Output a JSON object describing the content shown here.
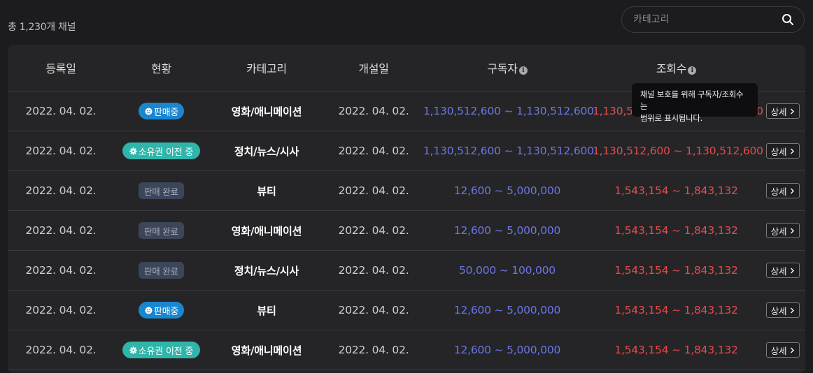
{
  "summary": "총 1,230개 채널",
  "search": {
    "placeholder": "카테고리"
  },
  "colors": {
    "subscribers": "#6b77e6",
    "views": "#e84a4a",
    "badge_sale": "#1a86d0",
    "badge_transfer": "#2fb5a9",
    "badge_done": "#3c4559"
  },
  "table": {
    "headers": [
      "등록일",
      "현황",
      "카테고리",
      "개설일",
      "구독자",
      "조회수",
      ""
    ],
    "rows": [
      {
        "registered": "2022. 04. 02.",
        "status": "판매중",
        "status_type": "sale",
        "category": "영화/애니메이션",
        "opened": "2022. 04. 02.",
        "subscribers": "1,130,512,600 ~ 1,130,512,600",
        "views": "1,130,512,600 ~ 1,130,512,600",
        "detail": "상세"
      },
      {
        "registered": "2022. 04. 02.",
        "status": "소유권 이전 중",
        "status_type": "transfer",
        "category": "정치/뉴스/시사",
        "opened": "2022. 04. 02.",
        "subscribers": "1,130,512,600 ~ 1,130,512,600",
        "views": "1,130,512,600 ~ 1,130,512,600",
        "detail": "상세"
      },
      {
        "registered": "2022. 04. 02.",
        "status": "판매 완료",
        "status_type": "done",
        "category": "뷰티",
        "opened": "2022. 04. 02.",
        "subscribers": "12,600 ~ 5,000,000",
        "views": "1,543,154 ~ 1,843,132",
        "detail": "상세"
      },
      {
        "registered": "2022. 04. 02.",
        "status": "판매 완료",
        "status_type": "done",
        "category": "영화/애니메이션",
        "opened": "2022. 04. 02.",
        "subscribers": "12,600 ~ 5,000,000",
        "views": "1,543,154 ~ 1,843,132",
        "detail": "상세"
      },
      {
        "registered": "2022. 04. 02.",
        "status": "판매 완료",
        "status_type": "done",
        "category": "정치/뉴스/시사",
        "opened": "2022. 04. 02.",
        "subscribers": "50,000 ~ 100,000",
        "views": "1,543,154 ~ 1,843,132",
        "detail": "상세"
      },
      {
        "registered": "2022. 04. 02.",
        "status": "판매중",
        "status_type": "sale",
        "category": "뷰티",
        "opened": "2022. 04. 02.",
        "subscribers": "12,600 ~ 5,000,000",
        "views": "1,543,154 ~ 1,843,132",
        "detail": "상세"
      },
      {
        "registered": "2022. 04. 02.",
        "status": "소유권 이전 중",
        "status_type": "transfer",
        "category": "영화/애니메이션",
        "opened": "2022. 04. 02.",
        "subscribers": "12,600 ~ 5,000,000",
        "views": "1,543,154 ~ 1,843,132",
        "detail": "상세"
      }
    ]
  },
  "tooltip": {
    "line1": "채널 보호를 위해 구독자/조회수는",
    "line2": "범위로 표시됩니다."
  }
}
